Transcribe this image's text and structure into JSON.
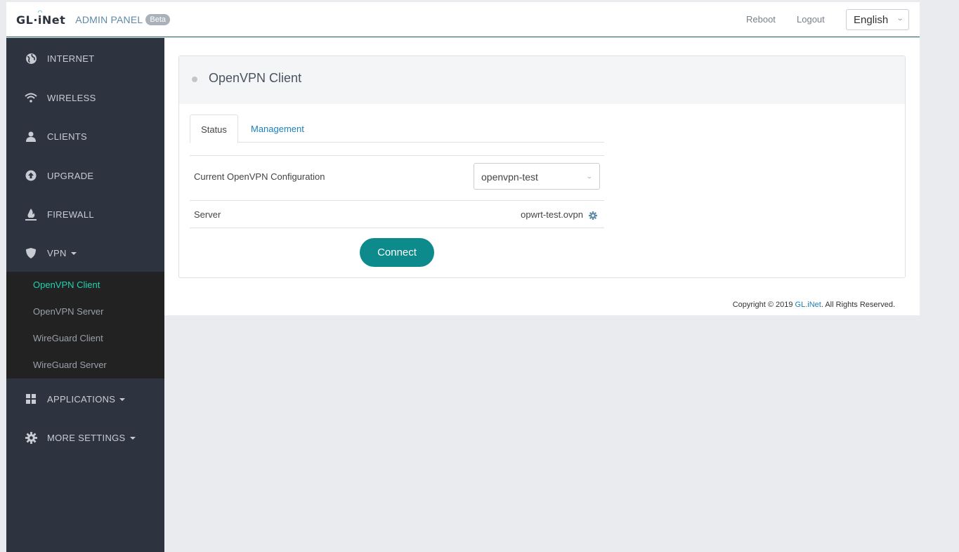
{
  "header": {
    "logo": "GL·iNet",
    "admin_panel": "ADMIN PANEL",
    "beta": "Beta",
    "reboot": "Reboot",
    "logout": "Logout",
    "language": "English"
  },
  "sidebar": {
    "items": [
      {
        "label": "INTERNET",
        "icon": "globe-icon"
      },
      {
        "label": "WIRELESS",
        "icon": "wifi-icon"
      },
      {
        "label": "CLIENTS",
        "icon": "user-icon"
      },
      {
        "label": "UPGRADE",
        "icon": "upgrade-icon"
      },
      {
        "label": "FIREWALL",
        "icon": "fire-icon"
      },
      {
        "label": "VPN",
        "icon": "shield-icon"
      },
      {
        "label": "APPLICATIONS",
        "icon": "grid-icon"
      },
      {
        "label": "MORE SETTINGS",
        "icon": "gear-icon"
      }
    ],
    "vpn_submenu": [
      {
        "label": "OpenVPN Client",
        "active": true
      },
      {
        "label": "OpenVPN Server",
        "active": false
      },
      {
        "label": "WireGuard Client",
        "active": false
      },
      {
        "label": "WireGuard Server",
        "active": false
      }
    ]
  },
  "main": {
    "title": "OpenVPN Client",
    "tabs": [
      {
        "label": "Status",
        "active": true
      },
      {
        "label": "Management",
        "active": false
      }
    ],
    "config_label": "Current OpenVPN Configuration",
    "config_value": "openvpn-test",
    "server_label": "Server",
    "server_value": "opwrt-test.ovpn",
    "connect_label": "Connect"
  },
  "footer": {
    "prefix": "Copyright © 2019 ",
    "brand": "GL.iNet",
    "suffix": ". All Rights Reserved."
  },
  "colors": {
    "sidebar_bg": "#2d3440",
    "submenu_bg": "#222222",
    "active_sub": "#21d3b3",
    "accent": "#0d8a8c",
    "link": "#1d7fb7"
  }
}
